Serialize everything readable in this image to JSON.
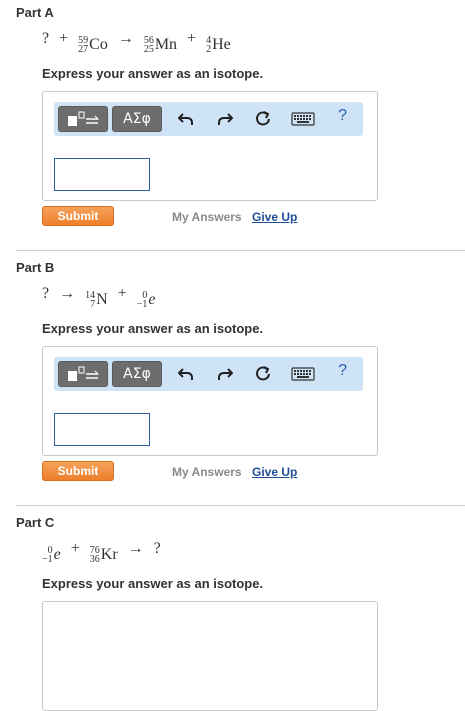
{
  "instruction": "Express your answer as an isotope.",
  "toolbar": {
    "greek_label": "ΑΣφ",
    "help_label": "?"
  },
  "actions": {
    "submit_label": "Submit",
    "my_answers_label": "My Answers",
    "give_up_label": "Give Up"
  },
  "parts": [
    {
      "title": "Part A",
      "equation": {
        "unknown": "?",
        "op1": "+",
        "n1": {
          "mass": "59",
          "atomic": "27",
          "symbol": "Co"
        },
        "arrow": "→",
        "n2": {
          "mass": "56",
          "atomic": "25",
          "symbol": "Mn"
        },
        "op2": "+",
        "n3": {
          "mass": "4",
          "atomic": "2",
          "symbol": "He"
        }
      }
    },
    {
      "title": "Part B",
      "equation": {
        "unknown": "?",
        "arrow": "→",
        "n1": {
          "mass": "14",
          "atomic": "7",
          "symbol": "N"
        },
        "op": "+",
        "n2": {
          "mass": "0",
          "atomic": "−1",
          "symbol": "e"
        }
      }
    },
    {
      "title": "Part C",
      "equation": {
        "n1": {
          "mass": "0",
          "atomic": "−1",
          "symbol": "e"
        },
        "op": "+",
        "n2": {
          "mass": "76",
          "atomic": "36",
          "symbol": "Kr"
        },
        "arrow": "→",
        "unknown": "?"
      }
    }
  ],
  "colors": {
    "toolbar_bg": "#cfe3f7",
    "submit_bg": "#ec7f2b",
    "link": "#1f4e96",
    "input_border": "#2e5f9e"
  },
  "icons": [
    "template-icon",
    "undo-icon",
    "redo-icon",
    "reset-icon",
    "keyboard-icon",
    "help-icon"
  ]
}
